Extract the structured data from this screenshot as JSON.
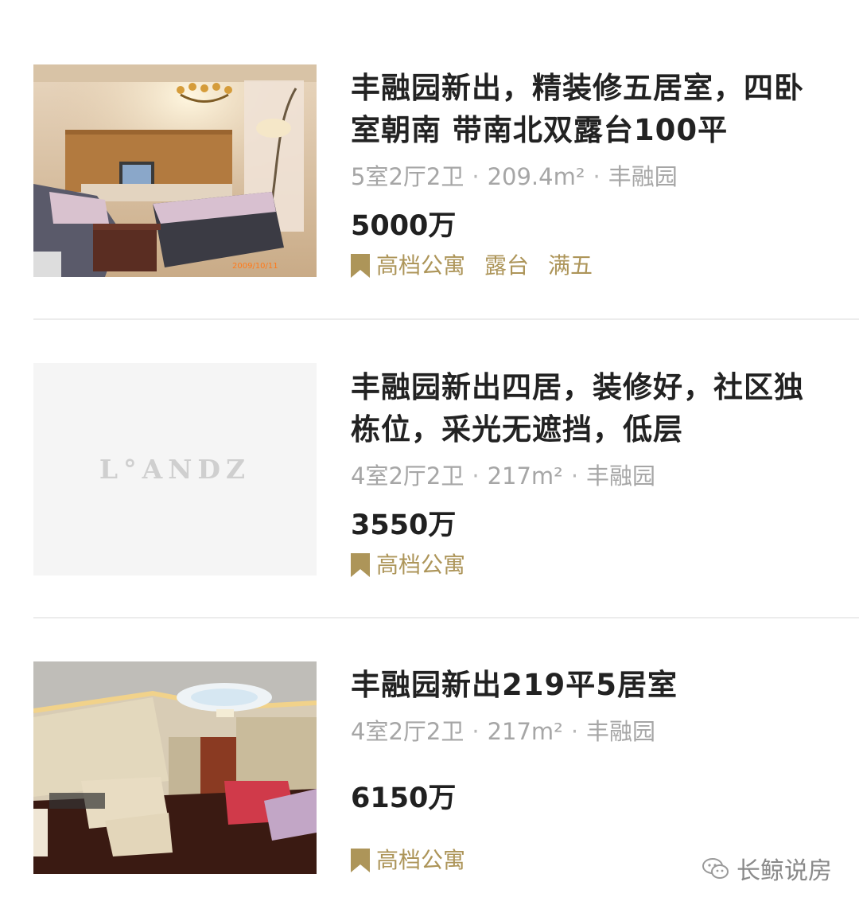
{
  "listings": [
    {
      "title": "丰融园新出，精装修五居室，四卧室朝南 带南北双露台100平",
      "rooms": "5室2厅2卫",
      "area": "209.4m²",
      "community": "丰融园",
      "price": "5000万",
      "tags": [
        "高档公寓",
        "露台",
        "满五"
      ],
      "photo_stamp": "2009/10/11"
    },
    {
      "title": "丰融园新出四居，装修好，社区独栋位，采光无遮挡，低层",
      "rooms": "4室2厅2卫",
      "area": "217m²",
      "community": "丰融园",
      "price": "3550万",
      "tags": [
        "高档公寓"
      ],
      "placeholder_logo": "L°ANDZ"
    },
    {
      "title": "丰融园新出219平5居室",
      "rooms": "4室2厅2卫",
      "area": "217m²",
      "community": "丰融园",
      "price": "6150万",
      "tags": [
        "高档公寓"
      ]
    }
  ],
  "separator": "·",
  "watermark": "长鲸说房",
  "colors": {
    "tag": "#ad9559",
    "meta": "#a6a6a6",
    "divider": "#ececec"
  }
}
